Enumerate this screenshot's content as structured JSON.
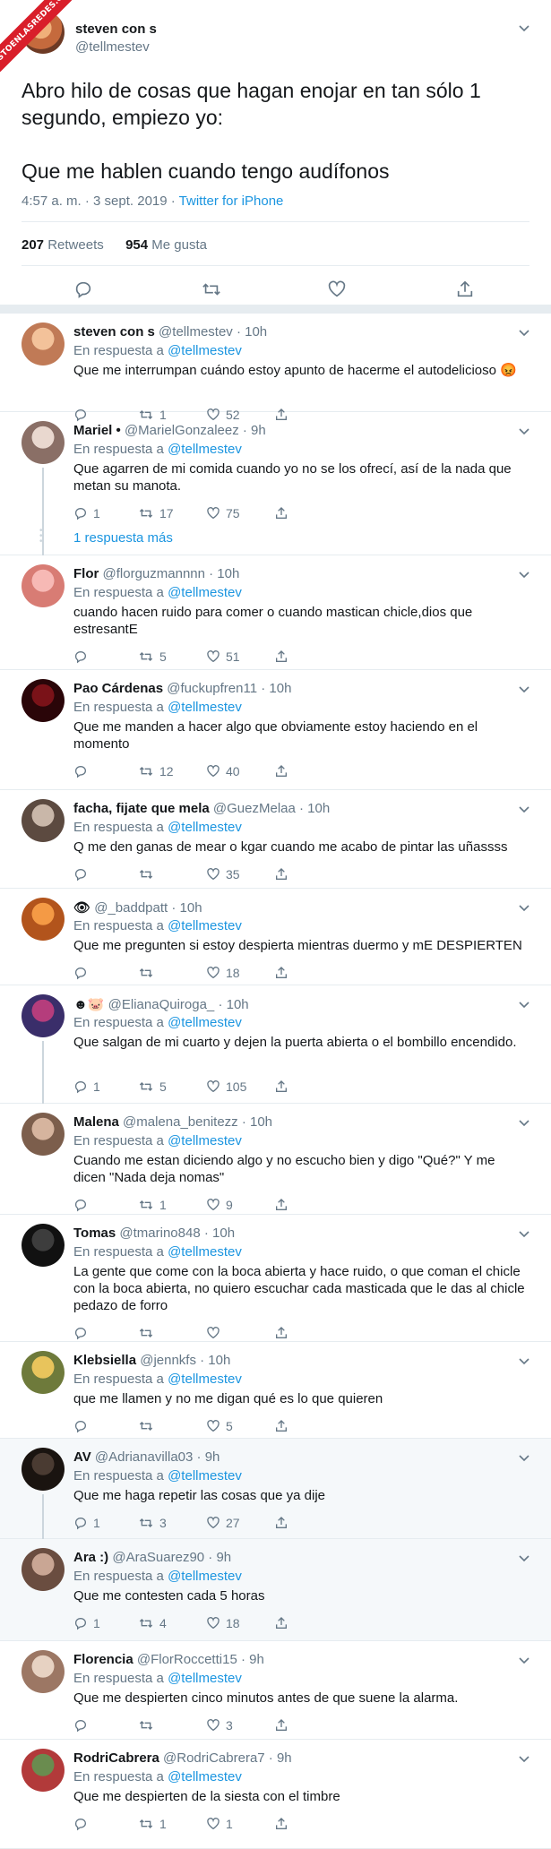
{
  "watermark": "VISTOENLASREDES.COM",
  "main": {
    "name": "steven con s",
    "handle": "@tellmestev",
    "text_line1": "Abro hilo de cosas que hagan enojar en tan sólo 1 segundo, empiezo yo:",
    "text_line2": "Que me hablen cuando tengo audífonos",
    "timestamp": "4:57 a. m. · 3 sept. 2019 ·",
    "source": "Twitter for iPhone",
    "retweets_count": "207",
    "retweets_label": "Retweets",
    "likes_count": "954",
    "likes_label": "Me gusta"
  },
  "in_reply_prefix": "En respuesta a",
  "replies": [
    {
      "name": "steven con s",
      "handle": "@tellmestev · 10h",
      "reply_to": "@tellmestev",
      "text": "Que me interrumpan cuándo estoy apunto de hacerme el autodelicioso 😡",
      "replies": "",
      "retweets": "1",
      "likes": "52"
    },
    {
      "name": "Mariel •",
      "handle": "@MarielGonzaleez · 9h",
      "reply_to": "@tellmestev",
      "text": "Que agarren de mi comida cuando yo no se los ofrecí, así de la nada que metan su manota.",
      "replies": "1",
      "retweets": "17",
      "likes": "75"
    },
    {
      "name": "Flor",
      "handle": "@florguzmannnn · 10h",
      "reply_to": "@tellmestev",
      "text": "cuando hacen ruido para comer o cuando mastican chicle,dios que estresantE",
      "replies": "",
      "retweets": "5",
      "likes": "51"
    },
    {
      "name": "Pao Cárdenas",
      "handle": "@fuckupfren11 · 10h",
      "reply_to": "@tellmestev",
      "text": "Que me manden a hacer algo que obviamente estoy haciendo en el momento",
      "replies": "",
      "retweets": "12",
      "likes": "40"
    },
    {
      "name": "facha, fijate que mela",
      "handle": "@GuezMelaa · 10h",
      "reply_to": "@tellmestev",
      "text": "Q me den ganas de mear o kgar cuando me acabo de pintar las uñassss",
      "replies": "",
      "retweets": "",
      "likes": "35"
    },
    {
      "name": "👁",
      "handle": "@_baddpatt · 10h",
      "reply_to": "@tellmestev",
      "text": "Que me pregunten si estoy despierta mientras duermo y mE DESPIERTEN",
      "replies": "",
      "retweets": "",
      "likes": "18"
    },
    {
      "name": "☻🐷",
      "handle": "@ElianaQuiroga_ · 10h",
      "reply_to": "@tellmestev",
      "text": "Que salgan de mi cuarto y dejen la puerta abierta o el bombillo encendido.",
      "replies": "1",
      "retweets": "5",
      "likes": "105"
    },
    {
      "name": "Malena",
      "handle": "@malena_benitezz · 10h",
      "reply_to": "@tellmestev",
      "text": "Cuando me estan diciendo algo y no escucho bien y digo \"Qué?\" Y me dicen \"Nada deja nomas\"",
      "replies": "",
      "retweets": "1",
      "likes": "9"
    },
    {
      "name": "Tomas",
      "handle": "@tmarino848 · 10h",
      "reply_to": "@tellmestev",
      "text": "La gente que come con la boca abierta y hace ruido, o que coman el chicle con la boca abierta, no quiero escuchar cada masticada que le das al chicle pedazo de forro",
      "replies": "",
      "retweets": "",
      "likes": ""
    },
    {
      "name": "Klebsiella",
      "handle": "@jennkfs · 10h",
      "reply_to": "@tellmestev",
      "text": "que me llamen y no me digan qué es lo que quieren",
      "replies": "",
      "retweets": "",
      "likes": "5"
    },
    {
      "name": "AV",
      "handle": "@Adrianavilla03 · 9h",
      "reply_to": "@tellmestev",
      "text": "Que me haga  repetir las cosas que ya dije",
      "replies": "1",
      "retweets": "3",
      "likes": "27"
    },
    {
      "name": "Ara :)",
      "handle": "@AraSuarez90 · 9h",
      "reply_to": "@tellmestev",
      "text": "Que me contesten cada 5 horas",
      "replies": "1",
      "retweets": "4",
      "likes": "18"
    },
    {
      "name": "Florencia",
      "handle": "@FlorRoccetti15 · 9h",
      "reply_to": "@tellmestev",
      "text": "Que me despierten cinco minutos antes de que suene la alarma.",
      "replies": "",
      "retweets": "",
      "likes": "3"
    },
    {
      "name": "RodriCabrera",
      "handle": "@RodriCabrera7 · 9h",
      "reply_to": "@tellmestev",
      "text": "Que me despierten de la siesta con el timbre",
      "replies": "",
      "retweets": "1",
      "likes": "1"
    }
  ],
  "more_replies": "1 respuesta más",
  "colors": {
    "link": "#1b95e0",
    "muted": "#657786",
    "border": "#e6ecf0",
    "text": "#14171a",
    "watermark": "#d91e2a"
  }
}
